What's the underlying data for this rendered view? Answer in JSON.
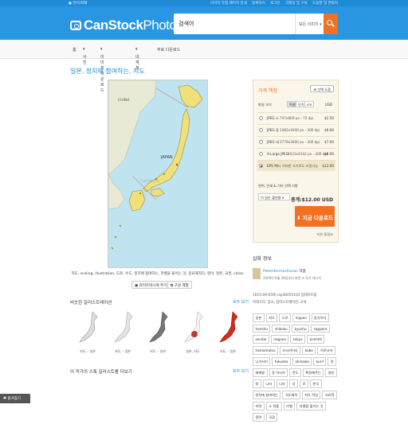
{
  "topbar": {
    "language": "언어/화폐",
    "links": [
      "이미지 유형 페이지 안내",
      "등록하기",
      "로그인",
      "크레딧 및 구독",
      "도움말 및 연락처"
    ]
  },
  "logo": {
    "text_main": "CanStock",
    "text_photo": "Photo"
  },
  "search": {
    "value": "검색어",
    "scope": "모든 이미지"
  },
  "nav": {
    "items": [
      "홈",
      "사진",
      "이미지 다운로드",
      "내 계정",
      "무료 다운로드"
    ]
  },
  "page": {
    "title": "일본, 정치에 참여하는, 지도",
    "caption": "지도, scaling, illustration, 도로, 수도, 정치에 참여하는, 라벨을 붙이는 것, 중요해지다, 영어, 일본, 국경, cities.",
    "btn_lightbox": "라이트박스에 추가",
    "btn_similar": "구성 계열"
  },
  "similar": {
    "title": "비슷한 일러스트레이션",
    "more": "모두 보기",
    "items": [
      "지도, - 일본",
      "지도, - 일본",
      "지도, - 일본",
      "일본, 지도",
      "지도, - 일본"
    ]
  },
  "more_by": {
    "title": "이 작가의 스톡 일러스트를 더보기",
    "more": "모두 보기"
  },
  "pricing": {
    "title": "가격 책정",
    "compare": "선택 도움",
    "col_size": "파일 크기",
    "units": [
      "픽셀",
      "인치",
      "cm"
    ],
    "col_usd": "USD",
    "rows": [
      {
        "name": "JPEG 소",
        "dims": "747x800 px - 72 dpi",
        "price": "$2.50",
        "selected": false
      },
      {
        "name": "JPEG 중",
        "dims": "1482x1600 px - 300 dpi",
        "price": "$6.00",
        "selected": false
      },
      {
        "name": "JPEG 대",
        "dims": "2779x3000 px - 300 dpi",
        "price": "$7.00",
        "selected": false
      },
      {
        "name": "X-Large JPEG",
        "dims": "4023x4342 px - 300 dpi",
        "price": "$8.00",
        "selected": false
      },
      {
        "name": "EPS 벡터",
        "dims": "어떠한 크기로도 조절가능",
        "price": "$12.00",
        "selected": true
      }
    ],
    "license_label": "면허, 인쇄 & 기타 선택 사항",
    "license_select": "이 일은 출판물",
    "total": "총계:$12.00 USD",
    "download": "지금 다운로드",
    "help": "지원 불필요"
  },
  "info": {
    "title": "삽화 정보",
    "author_name": "PeterHermesFurian",
    "author_suffix": "작품",
    "author_sub": "2009년 6월 28일부터 회원 ✉ 작가 메시지",
    "date_line": "2015-09-05에 csp30055103 업데이트됨",
    "category_line": "카테고리: 장소, 일러스트레이션, 교육"
  },
  "tags": [
    "일본",
    "지도",
    "도로",
    "nippon",
    "혼슈이다",
    "honshu",
    "shikoku",
    "kyushu",
    "sapporo",
    "sendai",
    "nagano",
    "tokyo",
    "요코하마",
    "hamamatsu",
    "오사카이다",
    "kobe",
    "히로시마",
    "나가사키",
    "fukuoka",
    "okinawa",
    "kuril",
    "원",
    "래해발",
    "동 아시아",
    "큰도",
    "확장해주는",
    "영인",
    "창",
    "나라",
    "나라",
    "앙",
    "로",
    "한국",
    "정치에 참여하는",
    "치도제작",
    "지도 작업",
    "지리학",
    "지역",
    "소 연출",
    "라벨",
    "라벨을 붙이는 것",
    "관련",
    "국경"
  ],
  "favorites": "즐겨찾기"
}
